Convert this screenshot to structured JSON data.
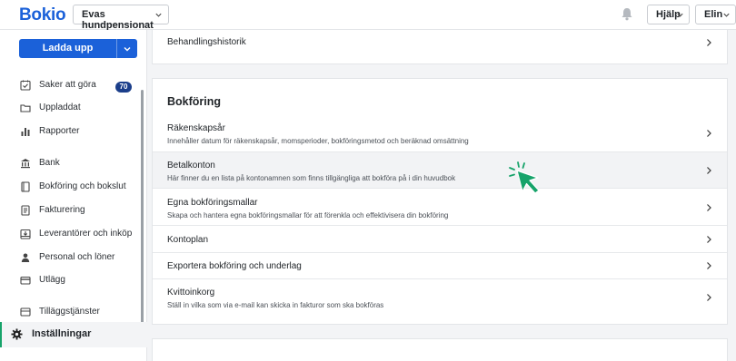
{
  "app": {
    "logo": "Bokio",
    "company": "Evas hundpensionat",
    "help": "Hjälp",
    "user": "Elin"
  },
  "colors": {
    "brand": "#1b61d9",
    "accent_green": "#16a36a",
    "badge": "#1b3e8a"
  },
  "sidebar": {
    "upload_label": "Ladda upp",
    "badge_count": "70",
    "items": [
      {
        "label": "Saker att göra",
        "icon": "checklist-icon"
      },
      {
        "label": "Uppladdat",
        "icon": "folder-icon"
      },
      {
        "label": "Rapporter",
        "icon": "bar-chart-icon"
      },
      {
        "label": "Bank",
        "icon": "bank-icon"
      },
      {
        "label": "Bokföring och bokslut",
        "icon": "book-icon"
      },
      {
        "label": "Fakturering",
        "icon": "invoice-icon"
      },
      {
        "label": "Leverantörer och inköp",
        "icon": "inbox-icon"
      },
      {
        "label": "Personal och löner",
        "icon": "person-icon"
      },
      {
        "label": "Utlägg",
        "icon": "card-icon"
      },
      {
        "label": "Tilläggstjänster",
        "icon": "addon-icon"
      }
    ],
    "settings_label": "Inställningar"
  },
  "top_card": {
    "title": "Behandlingshistorik"
  },
  "bookkeeping": {
    "heading": "Bokföring",
    "rows": [
      {
        "title": "Räkenskapsår",
        "subtitle": "Innehåller datum för räkenskapsår, momsperioder, bokföringsmetod och beräknad omsättning"
      },
      {
        "title": "Betalkonton",
        "subtitle": "Här finner du en lista på kontonamnen som finns tillgängliga att bokföra på i din huvudbok"
      },
      {
        "title": "Egna bokföringsmallar",
        "subtitle": "Skapa och hantera egna bokföringsmallar för att förenkla och effektivisera din bokföring"
      },
      {
        "title": "Kontoplan"
      },
      {
        "title": "Exportera bokföring och underlag"
      },
      {
        "title": "Kvittoinkorg",
        "subtitle": "Ställ in vilka som via e-mail kan skicka in fakturor som ska bokföras"
      }
    ]
  }
}
